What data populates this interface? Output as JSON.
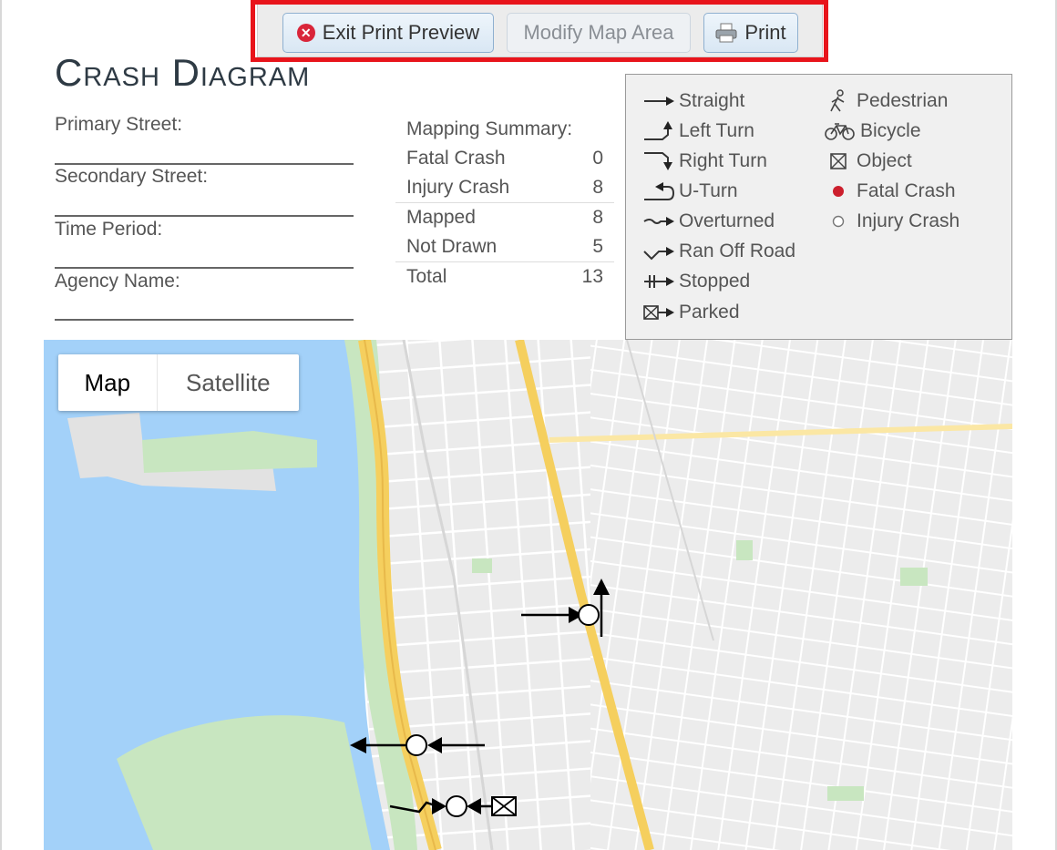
{
  "toolbar": {
    "exit_label": "Exit Print Preview",
    "modify_label": "Modify Map Area",
    "print_label": "Print"
  },
  "header": {
    "title": "Crash Diagram",
    "fields": [
      "Primary Street:",
      "Secondary Street:",
      "Time Period:",
      "Agency Name:"
    ]
  },
  "summary": {
    "heading": "Mapping Summary:",
    "rows": [
      {
        "label": "Fatal Crash",
        "value": "0"
      },
      {
        "label": "Injury Crash",
        "value": "8"
      },
      {
        "label": "Mapped",
        "value": "8"
      },
      {
        "label": "Not Drawn",
        "value": "5"
      },
      {
        "label": "Total",
        "value": "13"
      }
    ]
  },
  "legend": {
    "left": [
      "Straight",
      "Left Turn",
      "Right Turn",
      "U-Turn",
      "Overturned",
      "Ran Off Road",
      "Stopped",
      "Parked"
    ],
    "right": [
      "Pedestrian",
      "Bicycle",
      "Object",
      "Fatal Crash",
      "Injury Crash"
    ],
    "colors": {
      "fatal": "#cc1f2d",
      "injury": "#ffffff"
    }
  },
  "map": {
    "type_options": [
      "Map",
      "Satellite"
    ],
    "selected_type": "Map",
    "colors": {
      "water": "#a3d1f9",
      "park": "#c8e6c0",
      "land": "#efefef",
      "highway": "#f5cf5e",
      "street": "#ffffff"
    }
  }
}
